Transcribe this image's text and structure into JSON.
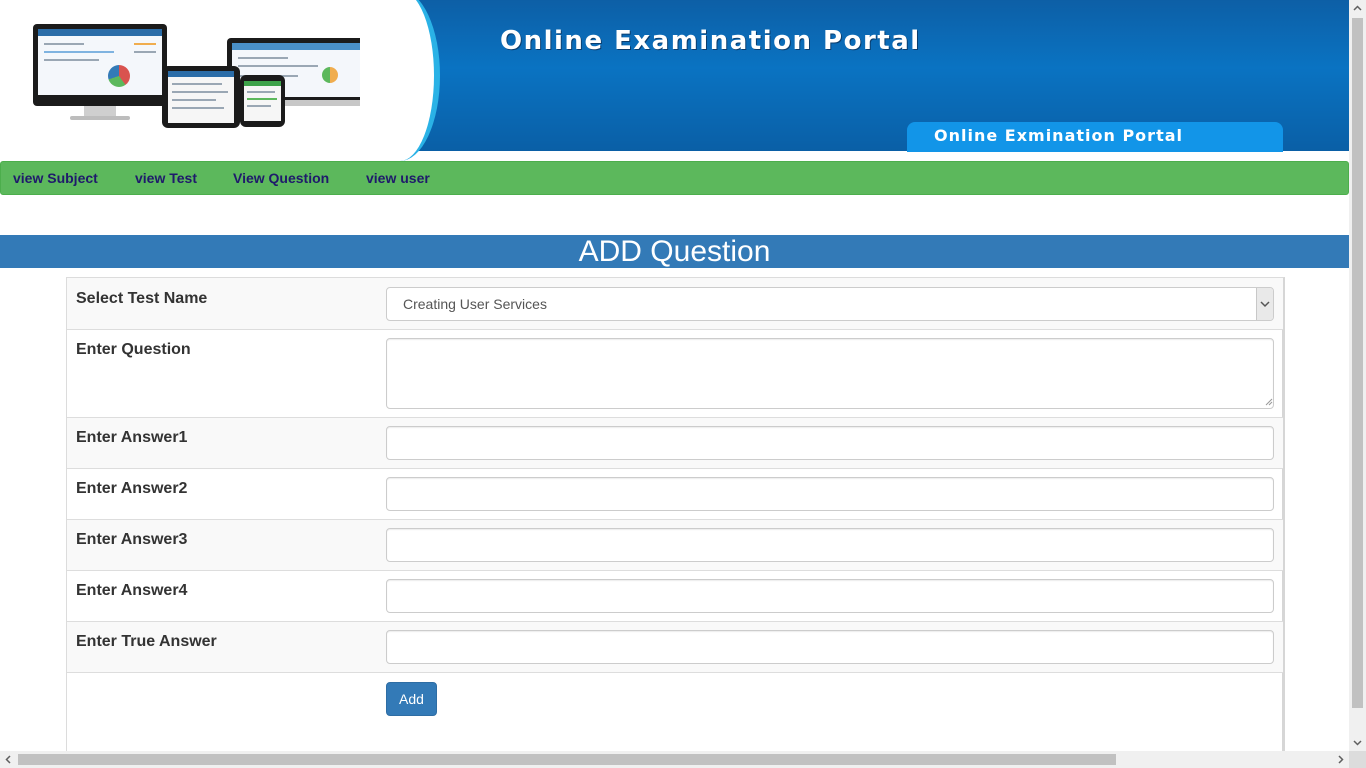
{
  "banner": {
    "title": "Online Examination Portal",
    "subtitle": "Online Exmination Portal",
    "illustration_icon": "devices-illustration"
  },
  "nav": {
    "items": [
      {
        "label": "view Subject"
      },
      {
        "label": "view Test"
      },
      {
        "label": "View Question"
      },
      {
        "label": "view user"
      }
    ]
  },
  "page": {
    "heading": "ADD Question"
  },
  "form": {
    "test_name_label": "Select Test Name",
    "test_name_selected": "Creating User Services",
    "question_label": "Enter Question",
    "question_value": "",
    "answer1_label": "Enter Answer1",
    "answer1_value": "",
    "answer2_label": "Enter Answer2",
    "answer2_value": "",
    "answer3_label": "Enter Answer3",
    "answer3_value": "",
    "answer4_label": "Enter Answer4",
    "answer4_value": "",
    "true_answer_label": "Enter True Answer",
    "true_answer_value": "",
    "submit_label": "Add"
  },
  "colors": {
    "nav_bg": "#5cb85c",
    "nav_text": "#1f1a6b",
    "heading_bg": "#337ab7",
    "button_bg": "#337ab7",
    "banner_blue": "#0a73c2"
  }
}
